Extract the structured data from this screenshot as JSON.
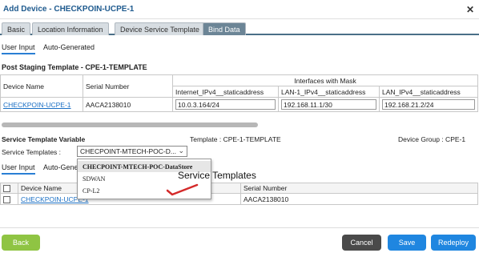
{
  "window": {
    "title": "Add Device - CHECKPOIN-UCPE-1",
    "close": "✕"
  },
  "tabs": [
    "Basic",
    "Location Information",
    "Device Service Template",
    "Bind Data"
  ],
  "subtabs_top": [
    "User Input",
    "Auto-Generated"
  ],
  "staging": {
    "title": "Post Staging Template - CPE-1-TEMPLATE",
    "col_device": "Device Name",
    "col_serial": "Serial Number",
    "col_group": "Interfaces with Mask",
    "col_if1": "Internet_IPv4__staticaddress",
    "col_if2": "LAN-1_IPv4__staticaddress",
    "col_if3": "LAN_IPv4__staticaddress",
    "row": {
      "device": "CHECKPOIN-UCPE-1",
      "serial": "AACA2138010",
      "if1": "10.0.3.164/24",
      "if2": "192.168.11.1/30",
      "if3": "192.168.21.2/24"
    }
  },
  "service": {
    "title": "Service Template Variable",
    "template_label": "Template : CPE-1-TEMPLATE",
    "group_label": "Device Group : CPE-1",
    "templates_label": "Service Templates :",
    "selected": "CHECPOINT-MTECH-POC-D...",
    "options": [
      "CHECPOINT-MTECH-POC-DataStore",
      "SDWAN",
      "CP-L2"
    ],
    "tooltip": "Service Templates"
  },
  "subtabs_bottom": [
    "User Input",
    "Auto-Gene"
  ],
  "bottom_table": {
    "col_device": "Device Name",
    "col_serial": "Serial Number",
    "row_device": "CHECKPOIN-UCPE-1",
    "row_serial": "AACA2138010"
  },
  "footer": {
    "back": "Back",
    "cancel": "Cancel",
    "save": "Save",
    "redeploy": "Redeploy"
  },
  "colors": {
    "accent": "#1f86e0",
    "back": "#8fc443",
    "cancel": "#4a4a4a",
    "tab_active": "#6c8596",
    "title": "#1e5a8e"
  }
}
